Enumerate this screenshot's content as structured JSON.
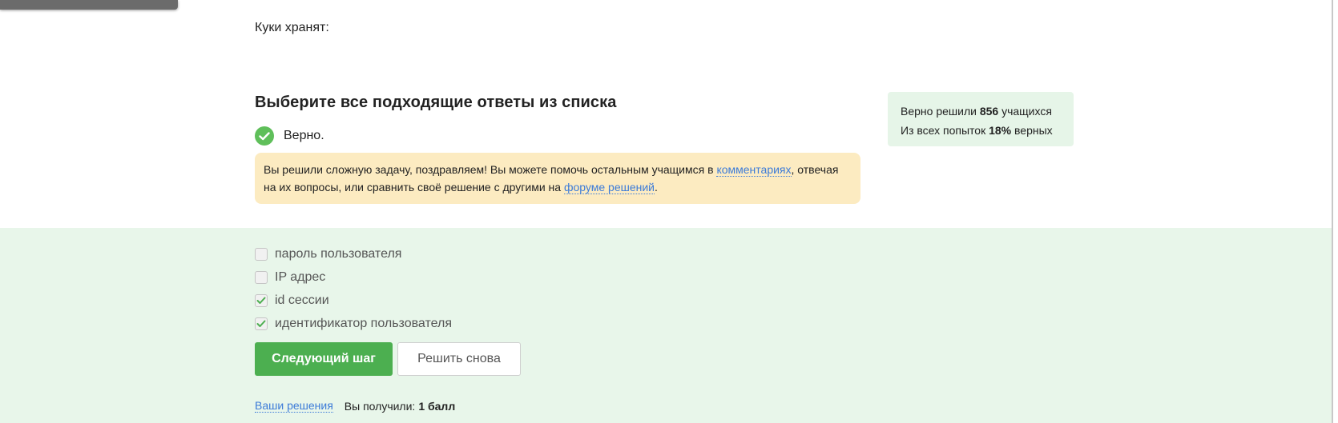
{
  "question": {
    "text": "Куки хранят:"
  },
  "instruction": "Выберите все подходящие ответы из списка",
  "status": {
    "text": "Верно.",
    "color": "#5fbf5a"
  },
  "congrats": {
    "part1": "Вы решили сложную задачу, поздравляем! Вы можете помочь остальным учащимся в ",
    "link1": "комментариях",
    "part2": ", отвечая на их вопросы, или сравнить своё решение с другими на ",
    "link2": "форуме решений",
    "part3": "."
  },
  "stats": {
    "line1_prefix": "Верно решили ",
    "solved_count": "856",
    "line1_suffix": " учащихся",
    "line2_prefix": "Из всех попыток ",
    "correct_percent": "18%",
    "line2_suffix": " верных"
  },
  "options": [
    {
      "label": "пароль пользователя",
      "checked": false
    },
    {
      "label": "IP адрес",
      "checked": false
    },
    {
      "label": "id сессии",
      "checked": true
    },
    {
      "label": "идентификатор пользователя",
      "checked": true
    }
  ],
  "buttons": {
    "next": "Следующий шаг",
    "retry": "Решить снова"
  },
  "footer": {
    "solutions_link": "Ваши решения",
    "score_label": "Вы получили:",
    "score_value": "1 балл"
  },
  "colors": {
    "accent": "#4caf50",
    "success_bg": "#e8f6ea",
    "notice_bg": "#fcebc1",
    "link": "#3c7bd8"
  }
}
